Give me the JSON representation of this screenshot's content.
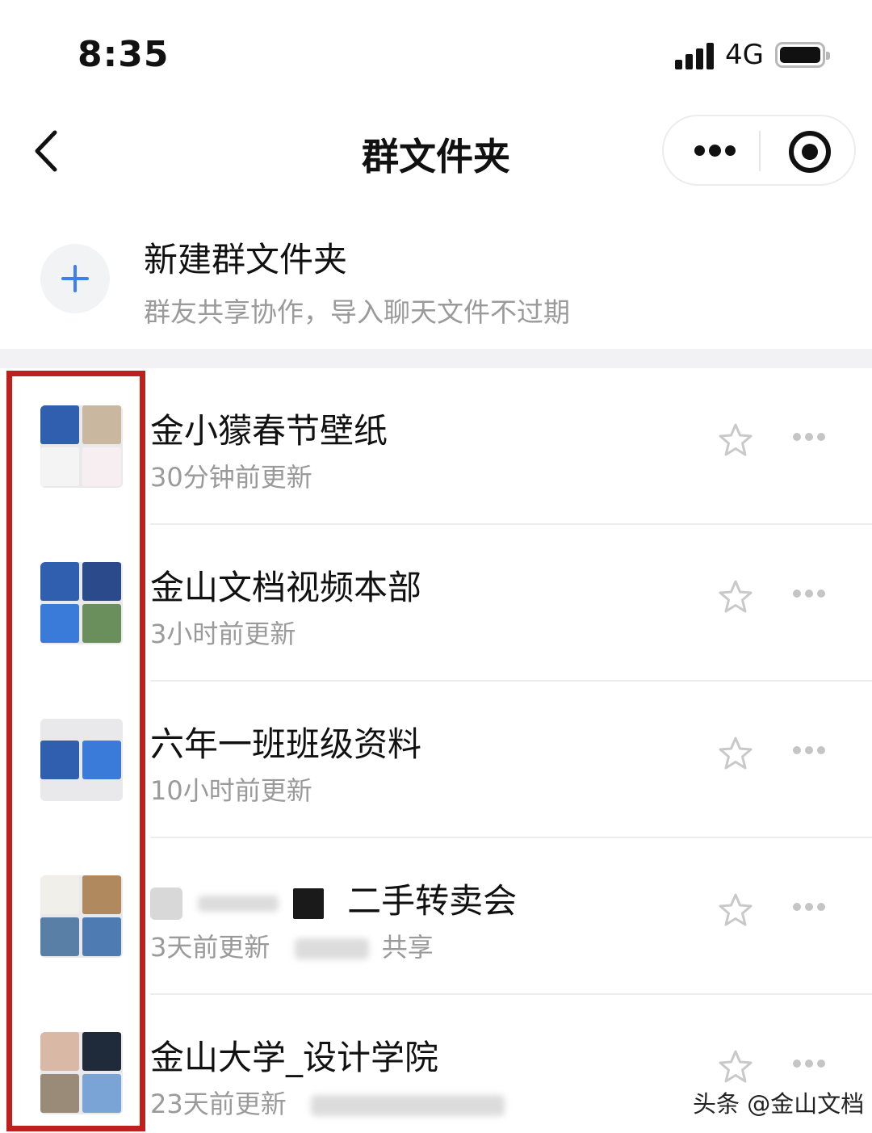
{
  "status_bar": {
    "time": "8:35",
    "network": "4G"
  },
  "nav": {
    "title": "群文件夹"
  },
  "new_folder": {
    "title": "新建群文件夹",
    "subtitle": "群友共享协作，导入聊天文件不过期"
  },
  "folders": [
    {
      "name": "金小獴春节壁纸",
      "meta": "30分钟前更新"
    },
    {
      "name": "金山文档视频本部",
      "meta": "3小时前更新"
    },
    {
      "name": "六年一班班级资料",
      "meta": "10小时前更新"
    },
    {
      "name": "二手转卖会",
      "meta": "3天前更新",
      "meta_suffix": "共享"
    },
    {
      "name": "金山大学_设计学院",
      "meta": "23天前更新"
    }
  ],
  "watermark": "头条 @金山文档",
  "colors": {
    "accent": "#3d7ff0",
    "highlight": "#c0201c"
  },
  "icons": [
    "back-icon",
    "more-icon",
    "target-icon",
    "plus-icon",
    "star-icon",
    "more-dots-icon"
  ]
}
